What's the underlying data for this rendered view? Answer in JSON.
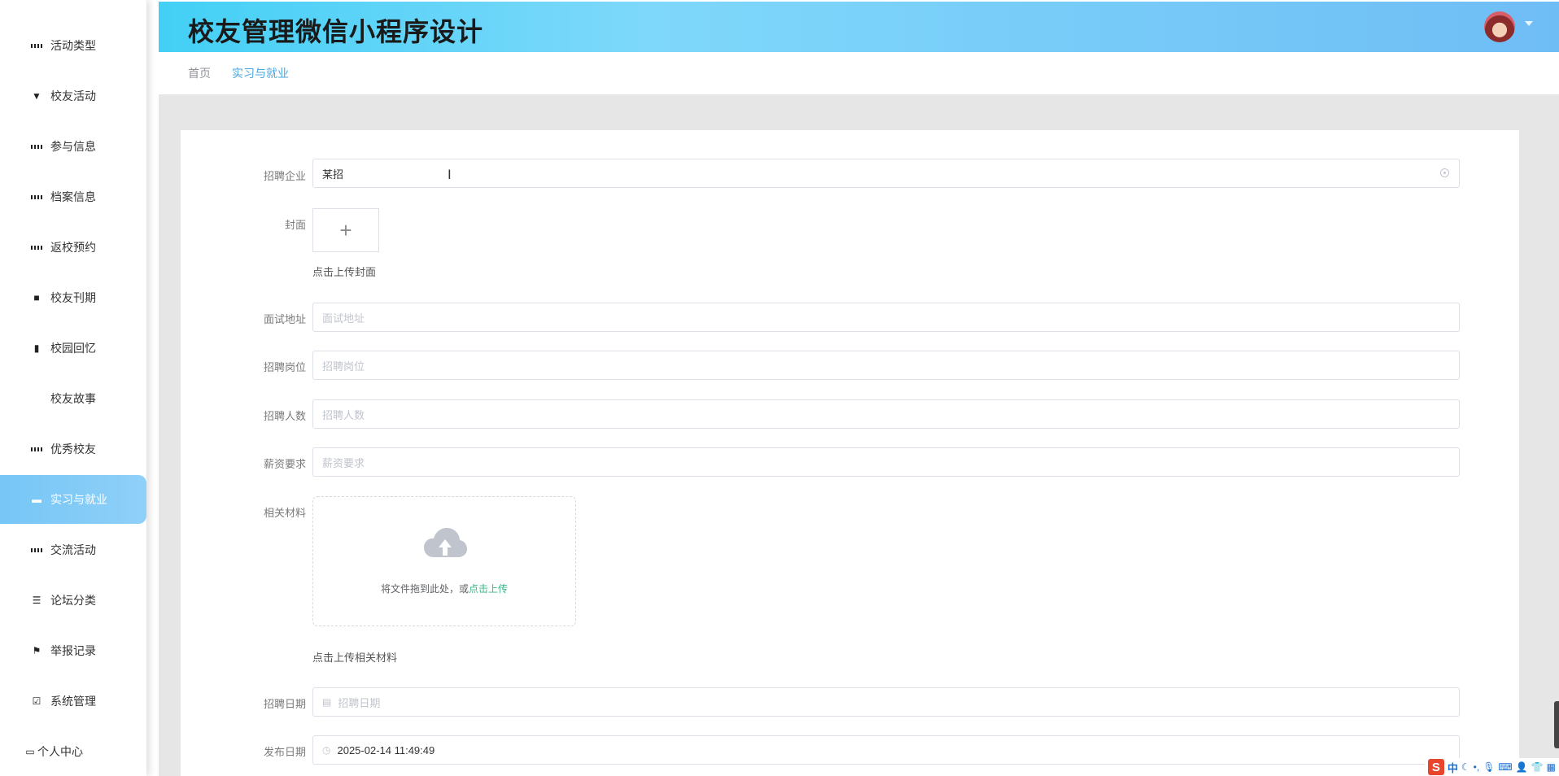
{
  "app": {
    "title": "校友管理微信小程序设计"
  },
  "sidebar": {
    "items": [
      {
        "label": "活动类型",
        "icon": "grid-icon"
      },
      {
        "label": "校友活动",
        "icon": "flag-pin-icon"
      },
      {
        "label": "参与信息",
        "icon": "grid-icon"
      },
      {
        "label": "档案信息",
        "icon": "grid-icon"
      },
      {
        "label": "返校预约",
        "icon": "grid-icon"
      },
      {
        "label": "校友刊期",
        "icon": "printer-icon"
      },
      {
        "label": "校园回忆",
        "icon": "books-icon"
      },
      {
        "label": "校友故事",
        "icon": "apps-icon"
      },
      {
        "label": "优秀校友",
        "icon": "grid-icon"
      },
      {
        "label": "实习与就业",
        "icon": "monitor-icon",
        "active": true
      },
      {
        "label": "交流活动",
        "icon": "grid-icon"
      },
      {
        "label": "论坛分类",
        "icon": "list-icon"
      },
      {
        "label": "举报记录",
        "icon": "flag-icon"
      },
      {
        "label": "系统管理",
        "icon": "clipboard-check-icon"
      }
    ],
    "personal": {
      "label": "个人中心",
      "icon": "id-card-icon"
    }
  },
  "breadcrumb": {
    "home": "首页",
    "current": "实习与就业"
  },
  "form": {
    "company": {
      "label": "招聘企业",
      "value": "某招"
    },
    "cover": {
      "label": "封面",
      "tip": "点击上传封面"
    },
    "address": {
      "label": "面试地址",
      "placeholder": "面试地址"
    },
    "position": {
      "label": "招聘岗位",
      "placeholder": "招聘岗位"
    },
    "headcount": {
      "label": "招聘人数",
      "placeholder": "招聘人数"
    },
    "salary": {
      "label": "薪资要求",
      "placeholder": "薪资要求"
    },
    "materials": {
      "label": "相关材料",
      "drag_text": "将文件拖到此处，或",
      "drag_link": "点击上传",
      "tip": "点击上传相关材料"
    },
    "recruit_date": {
      "label": "招聘日期",
      "placeholder": "招聘日期"
    },
    "publish_date": {
      "label": "发布日期",
      "value": "2025-02-14 11:49:49"
    }
  },
  "ime": {
    "logo": "S",
    "mode": "中"
  },
  "colors": {
    "header_gradient_start": "#43d0f5",
    "header_gradient_end": "#6fbdf5",
    "active_menu": "#76c6f6",
    "breadcrumb_active": "#4aa6de",
    "upload_link": "#3ab784"
  }
}
